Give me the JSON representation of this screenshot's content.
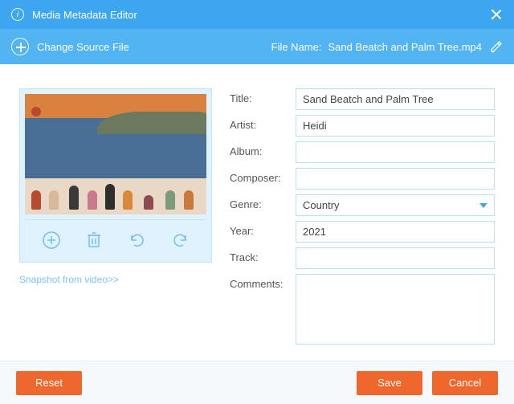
{
  "header": {
    "title": "Media Metadata Editor"
  },
  "subheader": {
    "changeSource": "Change Source File",
    "fileNameLabel": "File Name:",
    "fileName": "Sand Beatch and Palm Tree.mp4"
  },
  "thumbnail": {
    "snapshotLink": "Snapshot from video>>"
  },
  "fields": {
    "titleLabel": "Title:",
    "titleValue": "Sand Beatch and Palm Tree",
    "artistLabel": "Artist:",
    "artistValue": "Heidi",
    "albumLabel": "Album:",
    "albumValue": "",
    "composerLabel": "Composer:",
    "composerValue": "",
    "genreLabel": "Genre:",
    "genreValue": "Country",
    "yearLabel": "Year:",
    "yearValue": "2021",
    "trackLabel": "Track:",
    "trackValue": "",
    "commentsLabel": "Comments:",
    "commentsValue": ""
  },
  "buttons": {
    "reset": "Reset",
    "save": "Save",
    "cancel": "Cancel"
  }
}
